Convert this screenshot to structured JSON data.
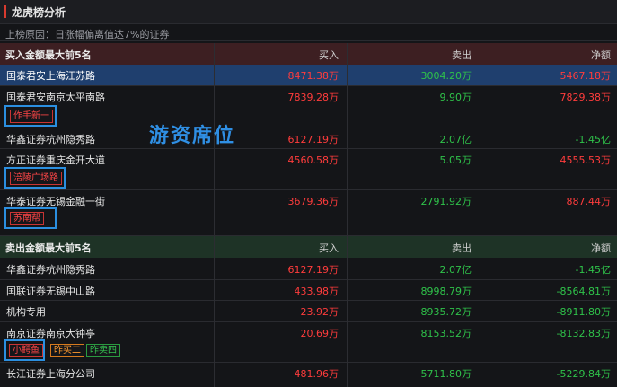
{
  "window": {
    "title": "龙虎榜分析"
  },
  "reason": "上榜原因：日涨幅偏离值达7%的证券",
  "overlay": "游资席位",
  "buy_section": {
    "title": "买入金额最大前5名",
    "col_buy": "买入",
    "col_sell": "卖出",
    "col_net": "净额",
    "rows": [
      {
        "name": "国泰君安上海江苏路",
        "buy": "8471.38万",
        "sell": "3004.20万",
        "net": "5467.18万"
      },
      {
        "name": "国泰君安南京太平南路",
        "buy": "7839.28万",
        "sell": "9.90万",
        "net": "7829.38万",
        "tag": "作手新一"
      },
      {
        "name": "华鑫证券杭州隐秀路",
        "buy": "6127.19万",
        "sell": "2.07亿",
        "net": "-1.45亿"
      },
      {
        "name": "方正证券重庆金开大道",
        "buy": "4560.58万",
        "sell": "5.05万",
        "net": "4555.53万",
        "tag": "涪陵广场路"
      },
      {
        "name": "华泰证券无锡金融一街",
        "buy": "3679.36万",
        "sell": "2791.92万",
        "net": "887.44万",
        "tag": "苏南帮"
      }
    ]
  },
  "sell_section": {
    "title": "卖出金额最大前5名",
    "col_buy": "买入",
    "col_sell": "卖出",
    "col_net": "净额",
    "rows": [
      {
        "name": "华鑫证券杭州隐秀路",
        "buy": "6127.19万",
        "sell": "2.07亿",
        "net": "-1.45亿"
      },
      {
        "name": "国联证券无锡中山路",
        "buy": "433.98万",
        "sell": "8998.79万",
        "net": "-8564.81万"
      },
      {
        "name": "机构专用",
        "buy": "23.92万",
        "sell": "8935.72万",
        "net": "-8911.80万"
      },
      {
        "name": "南京证券南京大钟亭",
        "buy": "20.69万",
        "sell": "8153.52万",
        "net": "-8132.83万",
        "tags": [
          "小鳄鱼",
          "昨买二",
          "昨卖四"
        ]
      },
      {
        "name": "长江证券上海分公司",
        "buy": "481.96万",
        "sell": "5711.80万",
        "net": "-5229.84万"
      }
    ]
  },
  "colors": {
    "positive": "#ff3c3c",
    "negative": "#2fc24a",
    "highlight": "#1f3f6e",
    "annotation": "#2b8fe0"
  }
}
